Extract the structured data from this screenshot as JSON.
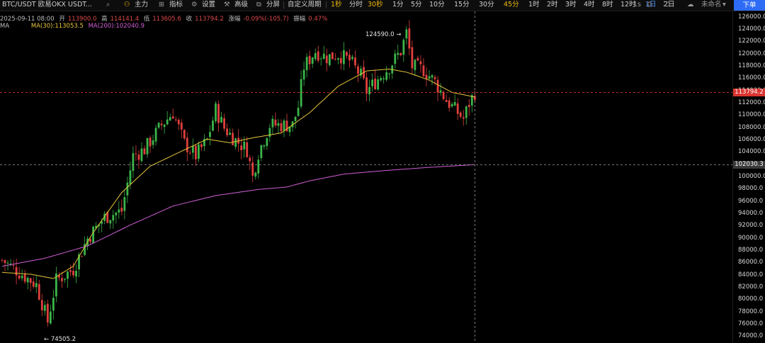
{
  "toolbar": {
    "symbol": "BTC/USDT 欧易OKX USDT...",
    "icons": [
      "search-icon",
      "main-chart-icon",
      "indicator-icon",
      "settings-icon",
      "advanced-icon",
      "split-screen-icon"
    ],
    "main_label": "主力",
    "indicators_label": "指标",
    "settings_label": "设置",
    "advanced_label": "高级",
    "split_label": "分屏",
    "custom_period_label": "自定义周期",
    "periods": [
      "1秒",
      "分时",
      "30秒",
      "1分",
      "5分",
      "10分",
      "15分",
      "30分",
      "45分",
      "1时",
      "2时",
      "3时",
      "4时",
      "8时",
      "12时",
      "1日",
      "2日"
    ],
    "active_period": "1日",
    "highlighted_periods": [
      "1秒",
      "30秒",
      "45分"
    ],
    "refresh_label": "1s",
    "account_label": "未命名",
    "order_button": "下单"
  },
  "ohlc": {
    "date": "2025-09-11 08:00",
    "open_label": "开",
    "open": "113900.0",
    "high_label": "高",
    "high": "114141.4",
    "low_label": "低",
    "low": "113605.6",
    "close_label": "收",
    "close": "113794.2",
    "change_label": "涨幅",
    "change": "-0.09%(-105.7)",
    "amplitude_label": "振幅",
    "amplitude": "0.47%"
  },
  "ma": {
    "label": "MA",
    "ma30_label": "MA(30):113053.5",
    "ma200_label": "MA(200):102040.9"
  },
  "colors": {
    "up": "#3bb54a",
    "down": "#e0403e",
    "ma30": "#e7c53b",
    "ma200": "#d05fd6",
    "price_tag": "#d9342f",
    "ma_tag": "#3a3a3a",
    "accent": "#f0b90b",
    "active": "#4f8ff7"
  },
  "chart_data": {
    "type": "candlestick",
    "yaxis_ticks": [
      "126000.0",
      "124000.0",
      "122000.0",
      "120000.0",
      "118000.0",
      "116000.0",
      "114000.0",
      "112000.0",
      "110000.0",
      "108000.0",
      "106000.0",
      "104000.0",
      "102000.0",
      "100000.0",
      "98000.0",
      "96000.0",
      "94000.0",
      "92000.0",
      "90000.0",
      "88000.0",
      "86000.0",
      "84000.0",
      "82000.0",
      "80000.0",
      "78000.0",
      "76000.0",
      "74000.0"
    ],
    "ylim": [
      73000,
      127000
    ],
    "current_price": "113794.2",
    "ma200_marker": "102030.3",
    "high_annotation": "124590.0",
    "low_annotation": "74505.2",
    "ma30_keypoints": [
      [
        0,
        84500
      ],
      [
        10,
        84200
      ],
      [
        18,
        83500
      ],
      [
        25,
        85500
      ],
      [
        32,
        91000
      ],
      [
        42,
        97500
      ],
      [
        52,
        101800
      ],
      [
        62,
        104000
      ],
      [
        72,
        106200
      ],
      [
        80,
        105600
      ],
      [
        88,
        106400
      ],
      [
        98,
        107200
      ],
      [
        108,
        110500
      ],
      [
        118,
        114800
      ],
      [
        128,
        117300
      ],
      [
        136,
        117600
      ],
      [
        142,
        117100
      ],
      [
        150,
        115800
      ],
      [
        158,
        113800
      ],
      [
        166,
        113053
      ]
    ],
    "ma200_keypoints": [
      [
        0,
        85500
      ],
      [
        15,
        86800
      ],
      [
        30,
        88800
      ],
      [
        45,
        92200
      ],
      [
        60,
        95300
      ],
      [
        75,
        97000
      ],
      [
        90,
        98000
      ],
      [
        100,
        98400
      ],
      [
        108,
        99400
      ],
      [
        120,
        100500
      ],
      [
        135,
        101100
      ],
      [
        150,
        101600
      ],
      [
        166,
        102040
      ]
    ],
    "close_keypoints": [
      [
        0,
        86500
      ],
      [
        6,
        84500
      ],
      [
        12,
        82500
      ],
      [
        16,
        76500
      ],
      [
        19,
        83200
      ],
      [
        25,
        85000
      ],
      [
        30,
        90000
      ],
      [
        36,
        93500
      ],
      [
        42,
        94500
      ],
      [
        46,
        103500
      ],
      [
        50,
        104500
      ],
      [
        56,
        108500
      ],
      [
        60,
        110500
      ],
      [
        64,
        105500
      ],
      [
        68,
        103500
      ],
      [
        72,
        106000
      ],
      [
        75,
        111000
      ],
      [
        78,
        108000
      ],
      [
        82,
        106000
      ],
      [
        86,
        104500
      ],
      [
        88,
        100000
      ],
      [
        90,
        104000
      ],
      [
        94,
        108500
      ],
      [
        98,
        108500
      ],
      [
        102,
        108500
      ],
      [
        104,
        111500
      ],
      [
        106,
        118000
      ],
      [
        110,
        120500
      ],
      [
        114,
        119500
      ],
      [
        118,
        120000
      ],
      [
        122,
        119000
      ],
      [
        126,
        116500
      ],
      [
        128,
        114000
      ],
      [
        132,
        116000
      ],
      [
        136,
        118000
      ],
      [
        140,
        120500
      ],
      [
        142,
        123500
      ],
      [
        144,
        118000
      ],
      [
        148,
        117500
      ],
      [
        152,
        115500
      ],
      [
        156,
        112500
      ],
      [
        160,
        110500
      ],
      [
        162,
        109500
      ],
      [
        164,
        112000
      ],
      [
        166,
        113794
      ]
    ]
  }
}
